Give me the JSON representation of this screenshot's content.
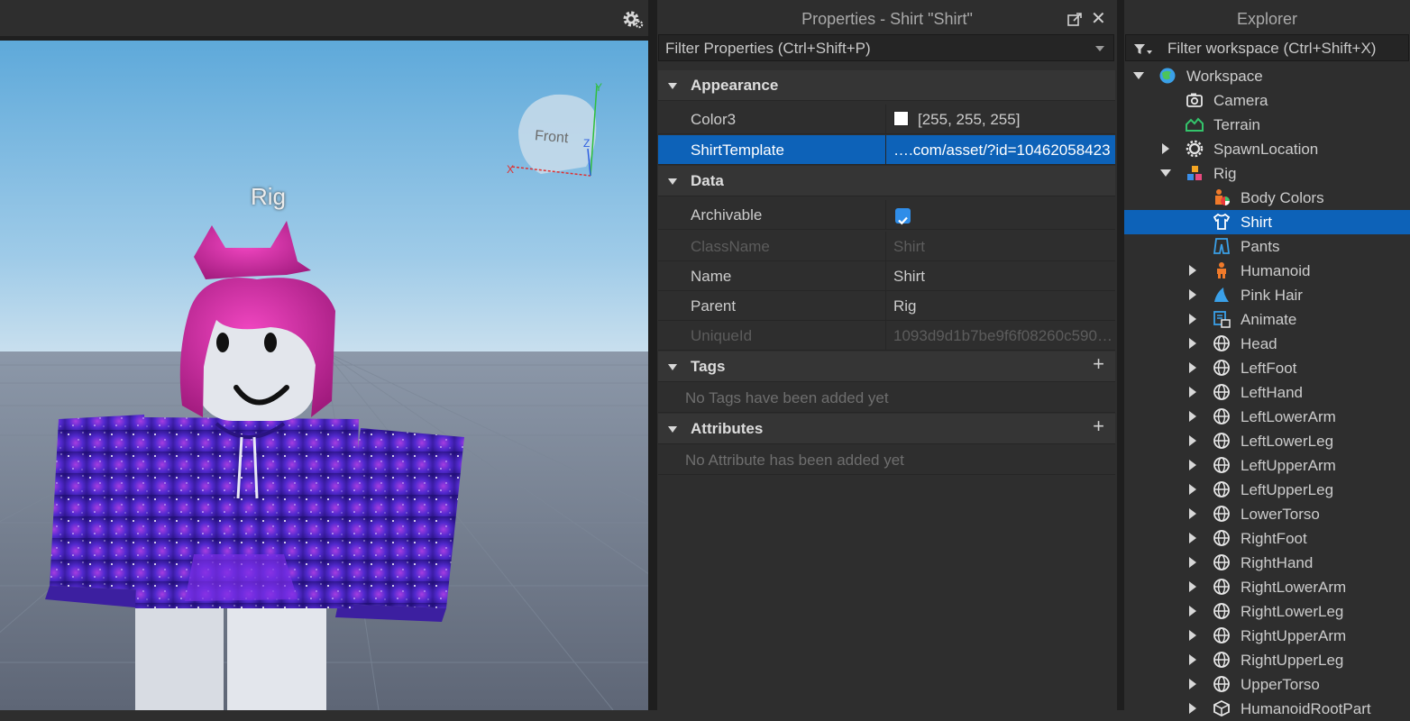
{
  "viewport": {
    "rig_label": "Rig",
    "gizmo": {
      "front_label": "Front",
      "axis_x": "X",
      "axis_y": "Y",
      "axis_z": "Z"
    }
  },
  "properties": {
    "title": "Properties - Shirt \"Shirt\"",
    "filter_placeholder": "Filter Properties (Ctrl+Shift+P)",
    "sections": {
      "appearance": "Appearance",
      "data": "Data",
      "tags": "Tags",
      "attributes": "Attributes"
    },
    "rows": {
      "color3": {
        "name": "Color3",
        "value": "[255, 255, 255]",
        "swatch_color": "#ffffff"
      },
      "shirt_template": {
        "name": "ShirtTemplate",
        "value": "….com/asset/?id=10462058423"
      },
      "archivable": {
        "name": "Archivable",
        "checked": true
      },
      "classname": {
        "name": "ClassName",
        "value": "Shirt"
      },
      "name": {
        "name": "Name",
        "value": "Shirt"
      },
      "parent": {
        "name": "Parent",
        "value": "Rig"
      },
      "uniqueid": {
        "name": "UniqueId",
        "value": "1093d9d1b7be9f6f08260c590…"
      }
    },
    "tags_empty": "No Tags have been added yet",
    "attributes_empty": "No Attribute has been added yet"
  },
  "explorer": {
    "title": "Explorer",
    "filter_placeholder": "Filter workspace (Ctrl+Shift+X)",
    "items": [
      {
        "label": "Workspace",
        "icon": "workspace-icon",
        "depth": 0,
        "expander": "open"
      },
      {
        "label": "Camera",
        "icon": "camera-icon",
        "depth": 1,
        "expander": "none"
      },
      {
        "label": "Terrain",
        "icon": "terrain-icon",
        "depth": 1,
        "expander": "none"
      },
      {
        "label": "SpawnLocation",
        "icon": "spawn-location-icon",
        "depth": 1,
        "expander": "closed"
      },
      {
        "label": "Rig",
        "icon": "model-icon",
        "depth": 1,
        "expander": "open"
      },
      {
        "label": "Body Colors",
        "icon": "body-colors-icon",
        "depth": 2,
        "expander": "none"
      },
      {
        "label": "Shirt",
        "icon": "shirt-icon",
        "depth": 2,
        "expander": "none",
        "selected": true
      },
      {
        "label": "Pants",
        "icon": "pants-icon",
        "depth": 2,
        "expander": "none"
      },
      {
        "label": "Humanoid",
        "icon": "humanoid-icon",
        "depth": 2,
        "expander": "closed"
      },
      {
        "label": "Pink Hair",
        "icon": "accessory-icon",
        "depth": 2,
        "expander": "closed"
      },
      {
        "label": "Animate",
        "icon": "local-script-icon",
        "depth": 2,
        "expander": "closed"
      },
      {
        "label": "Head",
        "icon": "mesh-part-icon",
        "depth": 2,
        "expander": "closed"
      },
      {
        "label": "LeftFoot",
        "icon": "mesh-part-icon",
        "depth": 2,
        "expander": "closed"
      },
      {
        "label": "LeftHand",
        "icon": "mesh-part-icon",
        "depth": 2,
        "expander": "closed"
      },
      {
        "label": "LeftLowerArm",
        "icon": "mesh-part-icon",
        "depth": 2,
        "expander": "closed"
      },
      {
        "label": "LeftLowerLeg",
        "icon": "mesh-part-icon",
        "depth": 2,
        "expander": "closed"
      },
      {
        "label": "LeftUpperArm",
        "icon": "mesh-part-icon",
        "depth": 2,
        "expander": "closed"
      },
      {
        "label": "LeftUpperLeg",
        "icon": "mesh-part-icon",
        "depth": 2,
        "expander": "closed"
      },
      {
        "label": "LowerTorso",
        "icon": "mesh-part-icon",
        "depth": 2,
        "expander": "closed"
      },
      {
        "label": "RightFoot",
        "icon": "mesh-part-icon",
        "depth": 2,
        "expander": "closed"
      },
      {
        "label": "RightHand",
        "icon": "mesh-part-icon",
        "depth": 2,
        "expander": "closed"
      },
      {
        "label": "RightLowerArm",
        "icon": "mesh-part-icon",
        "depth": 2,
        "expander": "closed"
      },
      {
        "label": "RightLowerLeg",
        "icon": "mesh-part-icon",
        "depth": 2,
        "expander": "closed"
      },
      {
        "label": "RightUpperArm",
        "icon": "mesh-part-icon",
        "depth": 2,
        "expander": "closed"
      },
      {
        "label": "RightUpperLeg",
        "icon": "mesh-part-icon",
        "depth": 2,
        "expander": "closed"
      },
      {
        "label": "UpperTorso",
        "icon": "mesh-part-icon",
        "depth": 2,
        "expander": "closed"
      },
      {
        "label": "HumanoidRootPart",
        "icon": "part-icon",
        "depth": 2,
        "expander": "closed"
      }
    ]
  },
  "colors": {
    "selection": "#0d62b8",
    "panel_bg": "#2e2e2e",
    "sky_top": "#5ea9da",
    "sky_bottom": "#c4dbea",
    "galaxy_purple": "#4b2bc7"
  }
}
